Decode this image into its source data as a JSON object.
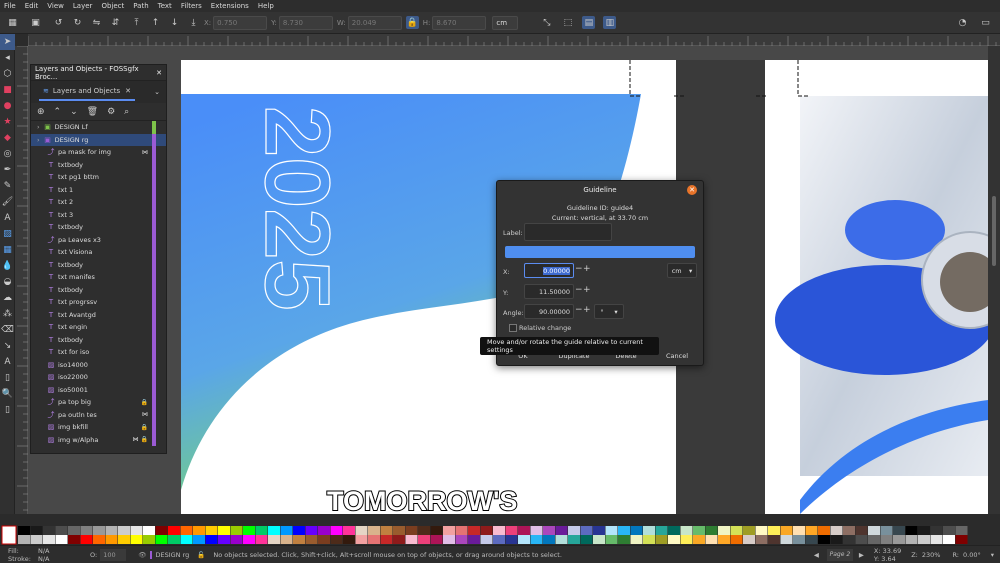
{
  "menu": [
    "File",
    "Edit",
    "View",
    "Layer",
    "Object",
    "Path",
    "Text",
    "Filters",
    "Extensions",
    "Help"
  ],
  "toolctl": {
    "x_label": "X:",
    "x_value": "0.750",
    "y_label": "Y:",
    "y_value": "8.730",
    "w_label": "W:",
    "w_value": "20.049",
    "h_label": "H:",
    "h_value": "8.670",
    "unit": "cm"
  },
  "panel": {
    "title": "Layers and Objects - FOSSgfx Broc...",
    "tab_label": "Layers and Objects",
    "rows": [
      {
        "label": "DESIGN  Lf",
        "type": "layer",
        "level": 0,
        "color": "#7ec34a"
      },
      {
        "label": "DESIGN  rg",
        "type": "layer",
        "level": 0,
        "color": "#9b5bd4",
        "selected": true
      },
      {
        "label": "pa   mask for img",
        "type": "path",
        "level": 1,
        "color": "#9b5bd4",
        "flag": "mask"
      },
      {
        "label": "txtbody",
        "type": "text",
        "level": 1,
        "color": "#9b5bd4"
      },
      {
        "label": "txt pg1 bttm",
        "type": "text",
        "level": 1,
        "color": "#9b5bd4"
      },
      {
        "label": "txt  1",
        "type": "text",
        "level": 1,
        "color": "#9b5bd4"
      },
      {
        "label": "txt  2",
        "type": "text",
        "level": 1,
        "color": "#9b5bd4"
      },
      {
        "label": "txt  3",
        "type": "text",
        "level": 1,
        "color": "#9b5bd4"
      },
      {
        "label": "txtbody",
        "type": "text",
        "level": 1,
        "color": "#9b5bd4"
      },
      {
        "label": "pa   Leaves x3",
        "type": "path",
        "level": 1,
        "color": "#9b5bd4"
      },
      {
        "label": "txt Visiona",
        "type": "text",
        "level": 1,
        "color": "#9b5bd4"
      },
      {
        "label": "txtbody",
        "type": "text",
        "level": 1,
        "color": "#9b5bd4"
      },
      {
        "label": "txt manifes",
        "type": "text",
        "level": 1,
        "color": "#9b5bd4"
      },
      {
        "label": "txtbody",
        "type": "text",
        "level": 1,
        "color": "#9b5bd4"
      },
      {
        "label": "txt progrssv",
        "type": "text",
        "level": 1,
        "color": "#9b5bd4"
      },
      {
        "label": "txt Avantgd",
        "type": "text",
        "level": 1,
        "color": "#9b5bd4"
      },
      {
        "label": "txt  engin",
        "type": "text",
        "level": 1,
        "color": "#9b5bd4"
      },
      {
        "label": "txtbody",
        "type": "text",
        "level": 1,
        "color": "#9b5bd4"
      },
      {
        "label": "txt for iso",
        "type": "text",
        "level": 1,
        "color": "#9b5bd4"
      },
      {
        "label": "iso14000",
        "type": "image",
        "level": 1,
        "color": "#9b5bd4"
      },
      {
        "label": "iso22000",
        "type": "image",
        "level": 1,
        "color": "#9b5bd4"
      },
      {
        "label": "iso50001",
        "type": "image",
        "level": 1,
        "color": "#9b5bd4"
      },
      {
        "label": "pa   top big",
        "type": "path",
        "level": 1,
        "color": "#9b5bd4",
        "flag": "lock"
      },
      {
        "label": "pa   outln tes",
        "type": "path",
        "level": 1,
        "color": "#9b5bd4",
        "flag": "mask"
      },
      {
        "label": "img   bkfill",
        "type": "image",
        "level": 1,
        "color": "#9b5bd4",
        "flag": "lock"
      },
      {
        "label": "img  w/Alpha",
        "type": "image",
        "level": 1,
        "color": "#9b5bd4",
        "flag": "masklock"
      }
    ]
  },
  "canvas": {
    "year_text": "2025",
    "headline": "TOMORROW'S"
  },
  "dialog": {
    "title": "Guideline",
    "guide_id": "Guideline ID: guide4",
    "current": "Current: vertical, at 33.70 cm",
    "label_label": "Label:",
    "guide_color": "#4f8ef0",
    "x_label": "X:",
    "x_value": "0.00000",
    "y_label": "Y:",
    "y_value": "11.50000",
    "angle_label": "Angle:",
    "angle_value": "90.00000",
    "unit": "cm",
    "angle_unit": "°",
    "relative_label": "Relative change",
    "ok": "OK",
    "duplicate": "Duplicate",
    "delete": "Delete",
    "cancel": "Cancel"
  },
  "tooltip": "Move and/or rotate the guide relative to current settings",
  "status": {
    "fill_label": "Fill:",
    "fill_value": "N/A",
    "stroke_label": "Stroke:",
    "stroke_value": "N/A",
    "opacity_label": "O:",
    "opacity_value": "100",
    "layer": "DESIGN  rg",
    "message": "No objects selected. Click, Shift+click, Alt+scroll mouse on top of objects, or drag around objects to select.",
    "page": "Page 2",
    "x_label": "X:",
    "x_value": "33.69",
    "y_label": "Y:",
    "y_value": "3.64",
    "zoom_label": "Z:",
    "zoom_value": "230%",
    "rot_label": "R:",
    "rot_value": "0.00°"
  }
}
